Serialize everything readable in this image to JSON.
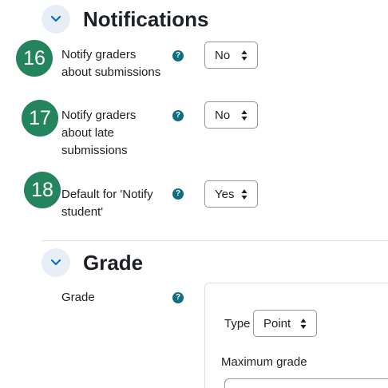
{
  "sections": {
    "notifications": {
      "title": "Notifications",
      "fields": [
        {
          "step": "16",
          "label": "Notify graders about submissions",
          "help": "?",
          "value": "No"
        },
        {
          "step": "17",
          "label": "Notify graders about late submissions",
          "help": "?",
          "value": "No"
        },
        {
          "step": "18",
          "label": "Default for 'Notify student'",
          "help": "?",
          "value": "Yes"
        }
      ]
    },
    "grade": {
      "title": "Grade",
      "field_label": "Grade",
      "help": "?",
      "type_label": "Type",
      "type_value": "Point",
      "max_grade_label": "Maximum grade"
    }
  },
  "colors": {
    "step_badge": "#23845d",
    "help_icon": "#0f6e84",
    "toggle_bg": "#e7eef8",
    "chevron": "#0f6cbf"
  }
}
